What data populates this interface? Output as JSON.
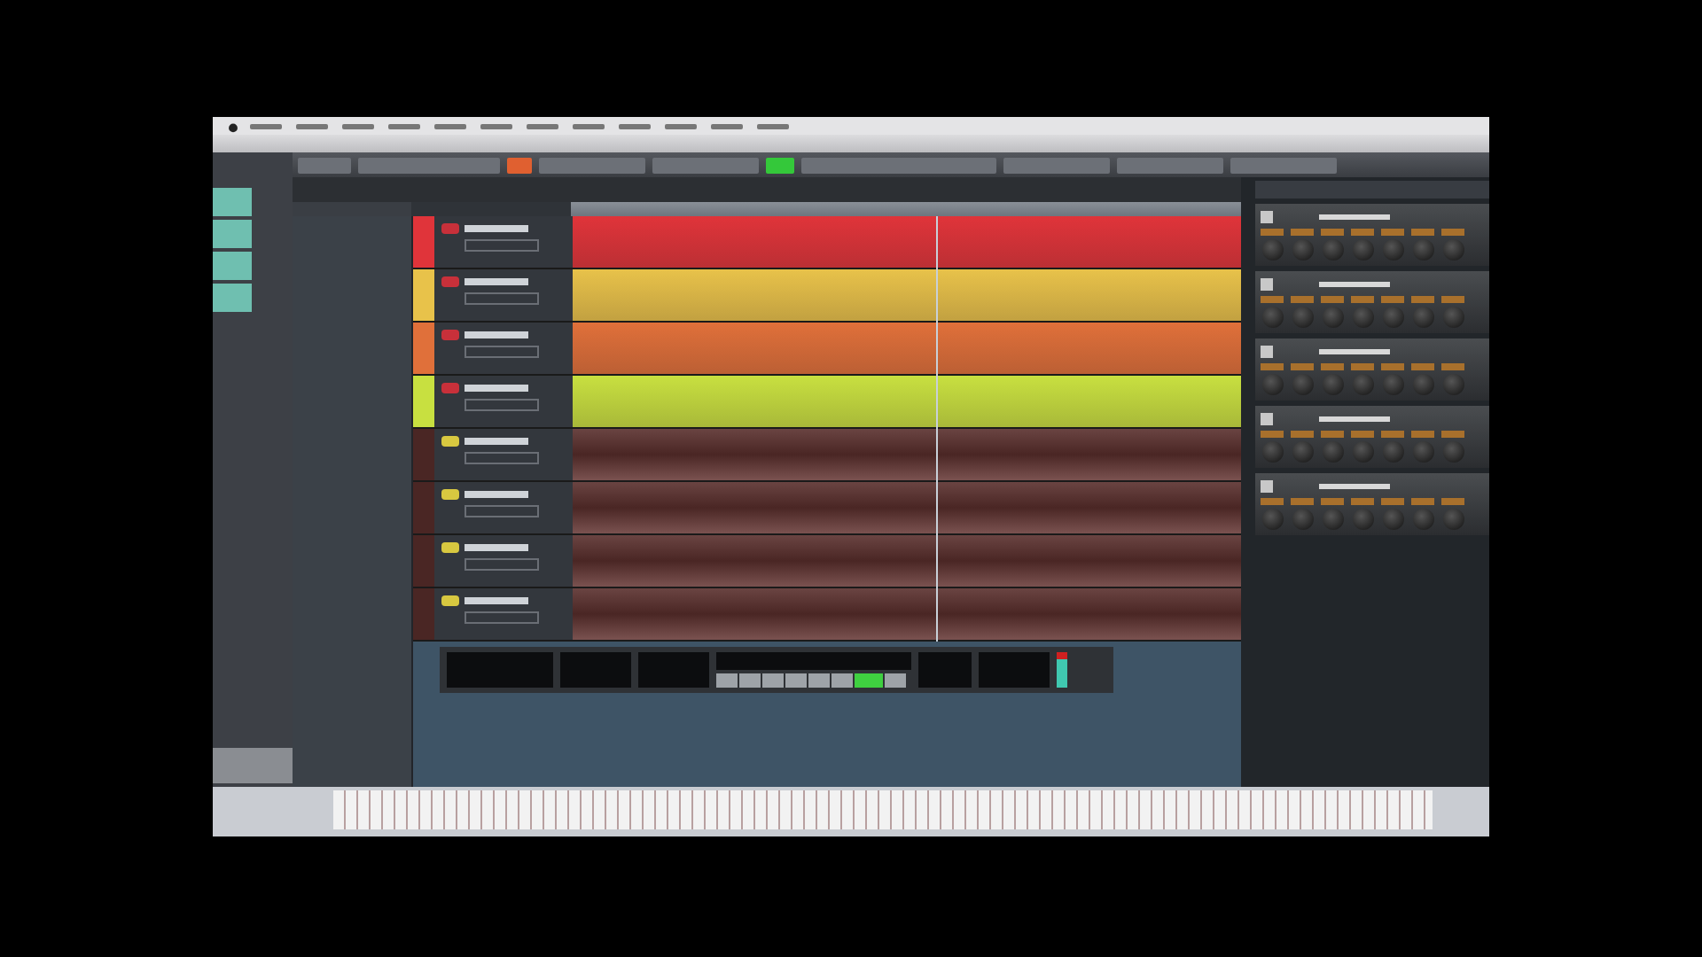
{
  "tracks": [
    {
      "kind": "instrument",
      "color": "#e0343a"
    },
    {
      "kind": "instrument",
      "color": "#e8c24a"
    },
    {
      "kind": "instrument",
      "color": "#e0703a"
    },
    {
      "kind": "instrument",
      "color": "#c8e040"
    },
    {
      "kind": "midi",
      "color": "#4a2624"
    },
    {
      "kind": "midi",
      "color": "#4a2624"
    },
    {
      "kind": "midi",
      "color": "#4a2624"
    },
    {
      "kind": "midi",
      "color": "#4a2624"
    }
  ],
  "transport": {
    "playing": true
  },
  "rack": {
    "slots": [
      {
        "expanded": true
      },
      {
        "expanded": true
      },
      {
        "expanded": true
      },
      {
        "expanded": true
      },
      {
        "expanded": true
      }
    ]
  }
}
